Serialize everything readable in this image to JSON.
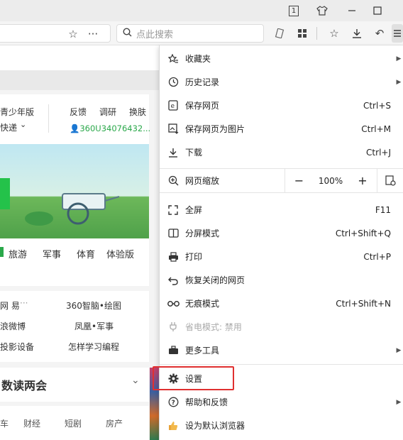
{
  "titlebar": {
    "icons": [
      "tab-count-icon",
      "shirt-icon",
      "minimize-icon",
      "maximize-icon"
    ],
    "tab_count": "1"
  },
  "toolbar": {
    "search_placeholder": "点此搜索"
  },
  "background_page": {
    "header_left_1": "青少年版",
    "header_left_2": "快递",
    "links": [
      "反馈",
      "调研",
      "换肤"
    ],
    "user_id": "360U34076432...",
    "nav_tabs": [
      "旅游",
      "军事",
      "体育",
      "体验版"
    ],
    "list_rows": [
      [
        "网 易",
        "360智脑•绘图"
      ],
      [
        "浪微博",
        "凤凰•军事"
      ],
      [
        "投影设备",
        "怎样学习编程"
      ]
    ],
    "section_title": "数读两会",
    "bottom_tabs": [
      "车",
      "财经",
      "短剧",
      "房产"
    ]
  },
  "menu": {
    "items": [
      {
        "icon": "star-list-icon",
        "label": "收藏夹",
        "shortcut": "",
        "submenu": true
      },
      {
        "icon": "history-clock-icon",
        "label": "历史记录",
        "shortcut": "",
        "submenu": true
      },
      {
        "icon": "save-page-icon",
        "label": "保存网页",
        "shortcut": "Ctrl+S",
        "submenu": false
      },
      {
        "icon": "save-image-icon",
        "label": "保存网页为图片",
        "shortcut": "Ctrl+M",
        "submenu": false
      },
      {
        "icon": "download-icon",
        "label": "下载",
        "shortcut": "Ctrl+J",
        "submenu": false
      }
    ],
    "zoom": {
      "label": "网页缩放",
      "minus": "−",
      "value": "100%",
      "plus": "+"
    },
    "items2": [
      {
        "icon": "fullscreen-icon",
        "label": "全屏",
        "shortcut": "F11"
      },
      {
        "icon": "split-screen-icon",
        "label": "分屏模式",
        "shortcut": "Ctrl+Shift+Q"
      },
      {
        "icon": "print-icon",
        "label": "打印",
        "shortcut": "Ctrl+P"
      },
      {
        "icon": "restore-icon",
        "label": "恢复关闭的网页",
        "shortcut": ""
      },
      {
        "icon": "incognito-icon",
        "label": "无痕模式",
        "shortcut": "Ctrl+Shift+N"
      },
      {
        "icon": "power-saving-icon",
        "label": "省电模式: 禁用",
        "shortcut": ""
      },
      {
        "icon": "toolbox-icon",
        "label": "更多工具",
        "shortcut": ""
      }
    ],
    "items3": [
      {
        "icon": "gear-icon",
        "label": "设置"
      },
      {
        "icon": "help-icon",
        "label": "帮助和反馈"
      },
      {
        "icon": "thumbs-up-icon",
        "label": "设为默认浏览器"
      }
    ]
  },
  "colors": {
    "highlight": "#e03030",
    "user_id_green": "#2aa84a"
  }
}
